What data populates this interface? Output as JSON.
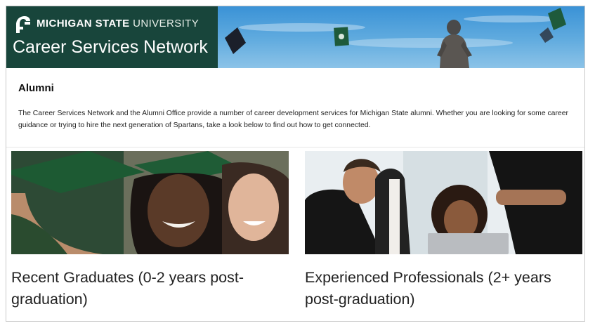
{
  "header": {
    "university_bold": "MICHIGAN STATE",
    "university_light": "UNIVERSITY",
    "network_title": "Career Services Network",
    "logo_icon": "spartan-helmet-icon",
    "brand_color": "#18453b"
  },
  "intro": {
    "title": "Alumni",
    "text": "The Career Services Network and the Alumni Office provide a number of career development services for Michigan State alumni. Whether you are looking for some career guidance or trying to hire the next generation of Spartans, take a look below to find out how to get connected."
  },
  "cards": [
    {
      "label": "Recent Graduates (0-2 years post-graduation)",
      "image": "graduates-photo"
    },
    {
      "label": "Experienced Professionals (2+ years post-graduation)",
      "image": "professionals-photo"
    }
  ]
}
